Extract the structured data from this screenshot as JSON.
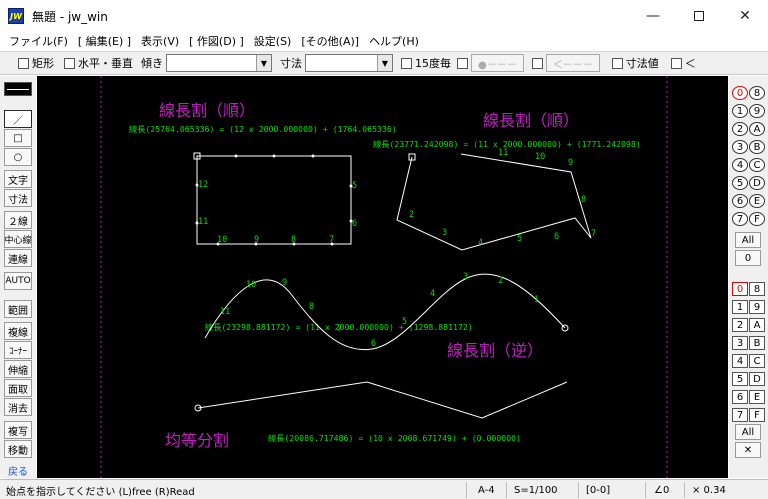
{
  "window": {
    "title": "無題 - jw_win",
    "app_icon": "JW"
  },
  "menu": [
    "ファイル(F)",
    "[ 編集(E) ]",
    "表示(V)",
    "[ 作図(D) ]",
    "設定(S)",
    "[その他(A)]",
    "ヘルプ(H)"
  ],
  "toolbar": {
    "rect": "矩形",
    "hv": "水平・垂直",
    "tilt": "傾き",
    "dim": "寸法",
    "every15": "15度毎",
    "btn1": "●－－－",
    "btn2": "＜－－－",
    "dimvalue": "寸法値",
    "lt": "＜"
  },
  "left_tools": [
    "／",
    "□",
    "○",
    "文字",
    "寸法",
    "２線",
    "中心線",
    "連線",
    "AUTO",
    "範囲",
    "複線",
    "ｺｰﾅｰ",
    "伸縮",
    "面取",
    "消去",
    "複写",
    "移動",
    "戻る"
  ],
  "layers_top": [
    "0",
    "8",
    "1",
    "9",
    "2",
    "A",
    "3",
    "B",
    "4",
    "C",
    "5",
    "D",
    "6",
    "E",
    "7",
    "F"
  ],
  "layers_top_all": "All",
  "layers_top_zero": "0",
  "layers_bottom": [
    "0",
    "8",
    "1",
    "9",
    "2",
    "A",
    "3",
    "B",
    "4",
    "C",
    "5",
    "D",
    "6",
    "E",
    "7",
    "F"
  ],
  "layers_bottom_all": "All",
  "layers_bottom_x": "✕",
  "drawing": {
    "label1": "線長割（順）",
    "label2": "線長割（順）",
    "label3": "線長割（逆）",
    "label4": "均等分割",
    "formula1": "線長(25764.065336) = (12 x 2000.000000) + (1764.065336)",
    "formula2": "線長(23771.242098) = (11 x 2000.000000) + (1771.242098)",
    "formula3": "線長(23298.881172) = (11 x 2000.000000) + (1298.881172)",
    "formula4": "線長(20086.717486) = (10 x 2008.671749) + (0.000000)",
    "rect_nums": [
      "12",
      "11",
      "10",
      "9",
      "8",
      "7",
      "6",
      "5"
    ],
    "poly_nums": [
      "11",
      "10",
      "9",
      "8",
      "7",
      "6",
      "5",
      "4",
      "3",
      "2"
    ],
    "wave_nums": [
      "11",
      "10",
      "9",
      "8",
      "7",
      "6",
      "5",
      "4",
      "3",
      "2",
      "1"
    ],
    "colors": {
      "label": "#c020c0",
      "text": "#00e000",
      "line": "#ffffff",
      "frame": "#c020c0"
    }
  },
  "status": {
    "message": "始点を指示してください (L)free (R)Read",
    "paper": "A-4",
    "scale": "S=1/100",
    "layer": "[0-0]",
    "angle": "∠0",
    "zoom": "× 0.34"
  }
}
